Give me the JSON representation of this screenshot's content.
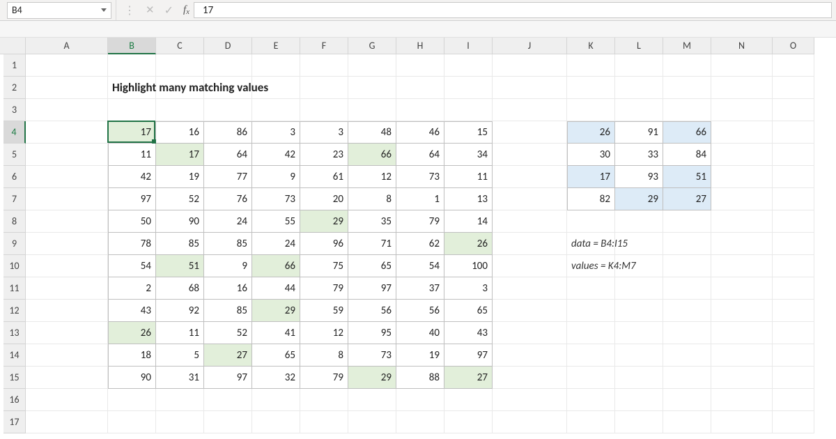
{
  "formula_bar": {
    "name_box": "B4",
    "formula": "17"
  },
  "columns": [
    "A",
    "B",
    "C",
    "D",
    "E",
    "F",
    "G",
    "H",
    "I",
    "J",
    "K",
    "L",
    "M",
    "N",
    "O"
  ],
  "row_count": 17,
  "active_cell": {
    "col": "B",
    "row": 4
  },
  "title": "Highlight many matching values",
  "notes": {
    "line1": "data = B4:I15",
    "line2": "values = K4:M7"
  },
  "data_table": {
    "range": "B4:I15",
    "rows": [
      [
        17,
        16,
        86,
        3,
        3,
        48,
        46,
        15
      ],
      [
        11,
        17,
        64,
        42,
        23,
        66,
        64,
        34
      ],
      [
        42,
        19,
        77,
        9,
        61,
        12,
        73,
        11
      ],
      [
        97,
        52,
        76,
        73,
        20,
        8,
        1,
        13
      ],
      [
        50,
        90,
        24,
        55,
        29,
        35,
        79,
        14
      ],
      [
        78,
        85,
        85,
        24,
        96,
        71,
        62,
        26
      ],
      [
        54,
        51,
        9,
        66,
        75,
        65,
        54,
        100
      ],
      [
        2,
        68,
        16,
        44,
        79,
        97,
        37,
        3
      ],
      [
        43,
        92,
        85,
        29,
        59,
        56,
        56,
        65
      ],
      [
        26,
        11,
        52,
        41,
        12,
        95,
        40,
        43
      ],
      [
        18,
        5,
        27,
        65,
        8,
        73,
        19,
        97
      ],
      [
        90,
        31,
        97,
        32,
        79,
        29,
        88,
        27
      ]
    ]
  },
  "values_table": {
    "range": "K4:M7",
    "rows": [
      [
        26,
        91,
        66
      ],
      [
        30,
        33,
        84
      ],
      [
        17,
        93,
        51
      ],
      [
        82,
        29,
        27
      ]
    ],
    "blue_cells": [
      "K4",
      "M4",
      "K6",
      "M6",
      "L7",
      "M7"
    ]
  },
  "match_values": [
    26,
    91,
    66,
    30,
    33,
    84,
    17,
    93,
    51,
    82,
    29,
    27
  ]
}
